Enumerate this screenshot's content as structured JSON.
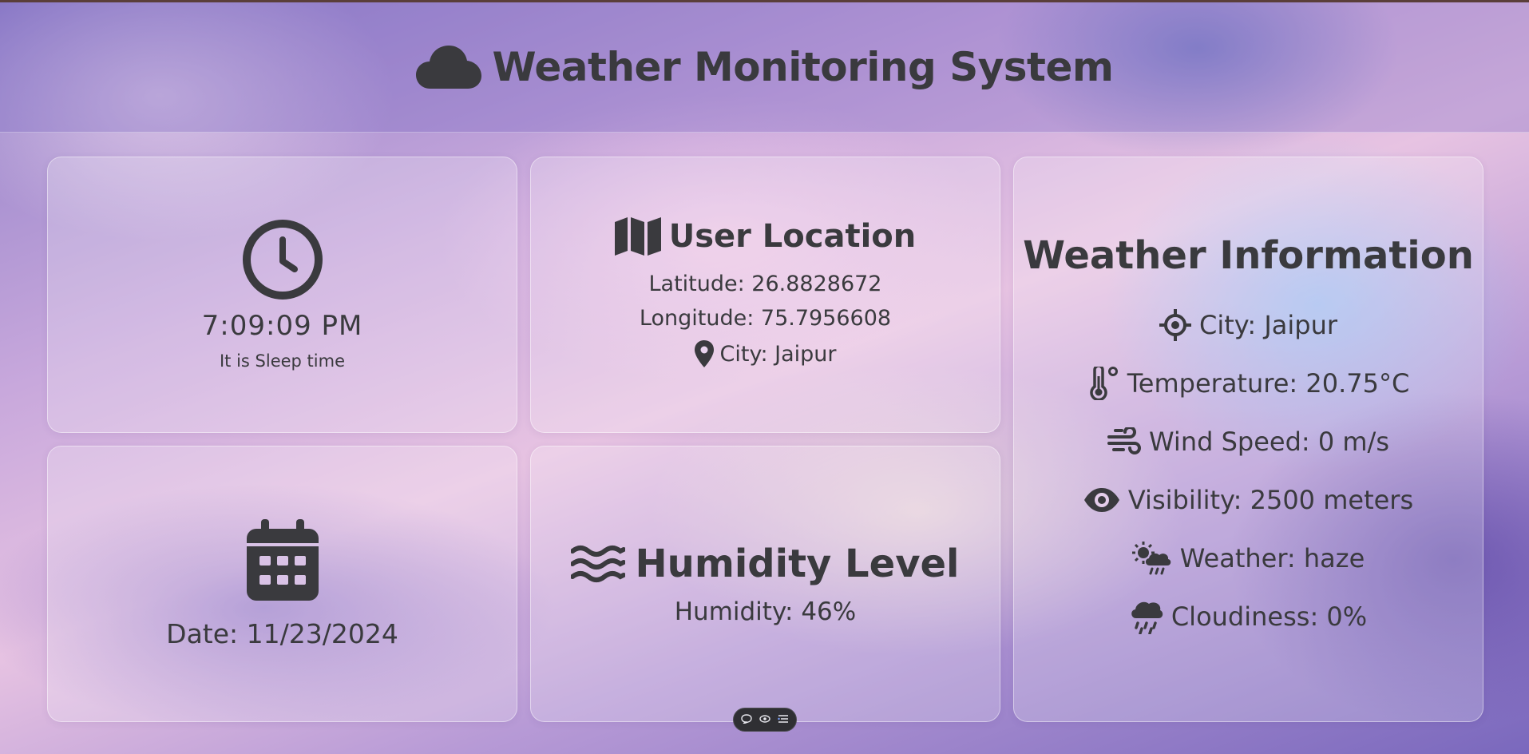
{
  "header": {
    "title": "Weather Monitoring System",
    "icon": "cloud-icon"
  },
  "clock": {
    "icon": "clock-icon",
    "time": "7:09:09 PM",
    "message": "It is Sleep time"
  },
  "location": {
    "icon": "map-icon",
    "title": "User Location",
    "latitude": "Latitude: 26.8828672",
    "longitude": "Longitude: 75.7956608",
    "city_icon": "map-pin-icon",
    "city": "City: Jaipur"
  },
  "date": {
    "icon": "calendar-icon",
    "text": "Date: 11/23/2024"
  },
  "humidity": {
    "icon": "water-waves-icon",
    "title": "Humidity Level",
    "value": "Humidity: 46%"
  },
  "weather": {
    "title": "Weather Information",
    "rows": [
      {
        "icon": "crosshair-icon",
        "text": "City: Jaipur"
      },
      {
        "icon": "thermometer-icon",
        "text": "Temperature: 20.75°C"
      },
      {
        "icon": "wind-icon",
        "text": "Wind Speed: 0 m/s"
      },
      {
        "icon": "eye-icon",
        "text": "Visibility: 2500 meters"
      },
      {
        "icon": "sun-cloud-rain-icon",
        "text": "Weather: haze"
      },
      {
        "icon": "cloud-rain-icon",
        "text": "Cloudiness: 0%"
      }
    ]
  },
  "toolbar": {
    "icons": [
      "comment-icon",
      "eye-toggle-icon",
      "list-icon"
    ]
  },
  "colors": {
    "text": "#3a3a3e",
    "toolbar_bg": "#2f2f33"
  }
}
